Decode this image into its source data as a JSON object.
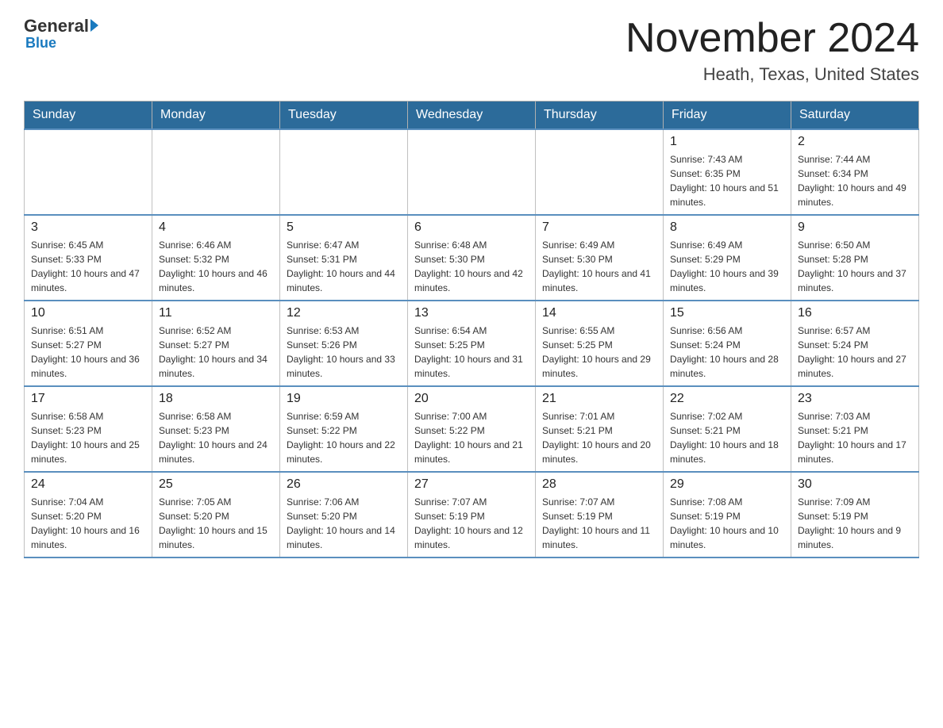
{
  "header": {
    "logo_general": "General",
    "logo_blue": "Blue",
    "month_title": "November 2024",
    "location": "Heath, Texas, United States"
  },
  "days_of_week": [
    "Sunday",
    "Monday",
    "Tuesday",
    "Wednesday",
    "Thursday",
    "Friday",
    "Saturday"
  ],
  "weeks": [
    [
      {
        "day": "",
        "sunrise": "",
        "sunset": "",
        "daylight": ""
      },
      {
        "day": "",
        "sunrise": "",
        "sunset": "",
        "daylight": ""
      },
      {
        "day": "",
        "sunrise": "",
        "sunset": "",
        "daylight": ""
      },
      {
        "day": "",
        "sunrise": "",
        "sunset": "",
        "daylight": ""
      },
      {
        "day": "",
        "sunrise": "",
        "sunset": "",
        "daylight": ""
      },
      {
        "day": "1",
        "sunrise": "Sunrise: 7:43 AM",
        "sunset": "Sunset: 6:35 PM",
        "daylight": "Daylight: 10 hours and 51 minutes."
      },
      {
        "day": "2",
        "sunrise": "Sunrise: 7:44 AM",
        "sunset": "Sunset: 6:34 PM",
        "daylight": "Daylight: 10 hours and 49 minutes."
      }
    ],
    [
      {
        "day": "3",
        "sunrise": "Sunrise: 6:45 AM",
        "sunset": "Sunset: 5:33 PM",
        "daylight": "Daylight: 10 hours and 47 minutes."
      },
      {
        "day": "4",
        "sunrise": "Sunrise: 6:46 AM",
        "sunset": "Sunset: 5:32 PM",
        "daylight": "Daylight: 10 hours and 46 minutes."
      },
      {
        "day": "5",
        "sunrise": "Sunrise: 6:47 AM",
        "sunset": "Sunset: 5:31 PM",
        "daylight": "Daylight: 10 hours and 44 minutes."
      },
      {
        "day": "6",
        "sunrise": "Sunrise: 6:48 AM",
        "sunset": "Sunset: 5:30 PM",
        "daylight": "Daylight: 10 hours and 42 minutes."
      },
      {
        "day": "7",
        "sunrise": "Sunrise: 6:49 AM",
        "sunset": "Sunset: 5:30 PM",
        "daylight": "Daylight: 10 hours and 41 minutes."
      },
      {
        "day": "8",
        "sunrise": "Sunrise: 6:49 AM",
        "sunset": "Sunset: 5:29 PM",
        "daylight": "Daylight: 10 hours and 39 minutes."
      },
      {
        "day": "9",
        "sunrise": "Sunrise: 6:50 AM",
        "sunset": "Sunset: 5:28 PM",
        "daylight": "Daylight: 10 hours and 37 minutes."
      }
    ],
    [
      {
        "day": "10",
        "sunrise": "Sunrise: 6:51 AM",
        "sunset": "Sunset: 5:27 PM",
        "daylight": "Daylight: 10 hours and 36 minutes."
      },
      {
        "day": "11",
        "sunrise": "Sunrise: 6:52 AM",
        "sunset": "Sunset: 5:27 PM",
        "daylight": "Daylight: 10 hours and 34 minutes."
      },
      {
        "day": "12",
        "sunrise": "Sunrise: 6:53 AM",
        "sunset": "Sunset: 5:26 PM",
        "daylight": "Daylight: 10 hours and 33 minutes."
      },
      {
        "day": "13",
        "sunrise": "Sunrise: 6:54 AM",
        "sunset": "Sunset: 5:25 PM",
        "daylight": "Daylight: 10 hours and 31 minutes."
      },
      {
        "day": "14",
        "sunrise": "Sunrise: 6:55 AM",
        "sunset": "Sunset: 5:25 PM",
        "daylight": "Daylight: 10 hours and 29 minutes."
      },
      {
        "day": "15",
        "sunrise": "Sunrise: 6:56 AM",
        "sunset": "Sunset: 5:24 PM",
        "daylight": "Daylight: 10 hours and 28 minutes."
      },
      {
        "day": "16",
        "sunrise": "Sunrise: 6:57 AM",
        "sunset": "Sunset: 5:24 PM",
        "daylight": "Daylight: 10 hours and 27 minutes."
      }
    ],
    [
      {
        "day": "17",
        "sunrise": "Sunrise: 6:58 AM",
        "sunset": "Sunset: 5:23 PM",
        "daylight": "Daylight: 10 hours and 25 minutes."
      },
      {
        "day": "18",
        "sunrise": "Sunrise: 6:58 AM",
        "sunset": "Sunset: 5:23 PM",
        "daylight": "Daylight: 10 hours and 24 minutes."
      },
      {
        "day": "19",
        "sunrise": "Sunrise: 6:59 AM",
        "sunset": "Sunset: 5:22 PM",
        "daylight": "Daylight: 10 hours and 22 minutes."
      },
      {
        "day": "20",
        "sunrise": "Sunrise: 7:00 AM",
        "sunset": "Sunset: 5:22 PM",
        "daylight": "Daylight: 10 hours and 21 minutes."
      },
      {
        "day": "21",
        "sunrise": "Sunrise: 7:01 AM",
        "sunset": "Sunset: 5:21 PM",
        "daylight": "Daylight: 10 hours and 20 minutes."
      },
      {
        "day": "22",
        "sunrise": "Sunrise: 7:02 AM",
        "sunset": "Sunset: 5:21 PM",
        "daylight": "Daylight: 10 hours and 18 minutes."
      },
      {
        "day": "23",
        "sunrise": "Sunrise: 7:03 AM",
        "sunset": "Sunset: 5:21 PM",
        "daylight": "Daylight: 10 hours and 17 minutes."
      }
    ],
    [
      {
        "day": "24",
        "sunrise": "Sunrise: 7:04 AM",
        "sunset": "Sunset: 5:20 PM",
        "daylight": "Daylight: 10 hours and 16 minutes."
      },
      {
        "day": "25",
        "sunrise": "Sunrise: 7:05 AM",
        "sunset": "Sunset: 5:20 PM",
        "daylight": "Daylight: 10 hours and 15 minutes."
      },
      {
        "day": "26",
        "sunrise": "Sunrise: 7:06 AM",
        "sunset": "Sunset: 5:20 PM",
        "daylight": "Daylight: 10 hours and 14 minutes."
      },
      {
        "day": "27",
        "sunrise": "Sunrise: 7:07 AM",
        "sunset": "Sunset: 5:19 PM",
        "daylight": "Daylight: 10 hours and 12 minutes."
      },
      {
        "day": "28",
        "sunrise": "Sunrise: 7:07 AM",
        "sunset": "Sunset: 5:19 PM",
        "daylight": "Daylight: 10 hours and 11 minutes."
      },
      {
        "day": "29",
        "sunrise": "Sunrise: 7:08 AM",
        "sunset": "Sunset: 5:19 PM",
        "daylight": "Daylight: 10 hours and 10 minutes."
      },
      {
        "day": "30",
        "sunrise": "Sunrise: 7:09 AM",
        "sunset": "Sunset: 5:19 PM",
        "daylight": "Daylight: 10 hours and 9 minutes."
      }
    ]
  ]
}
